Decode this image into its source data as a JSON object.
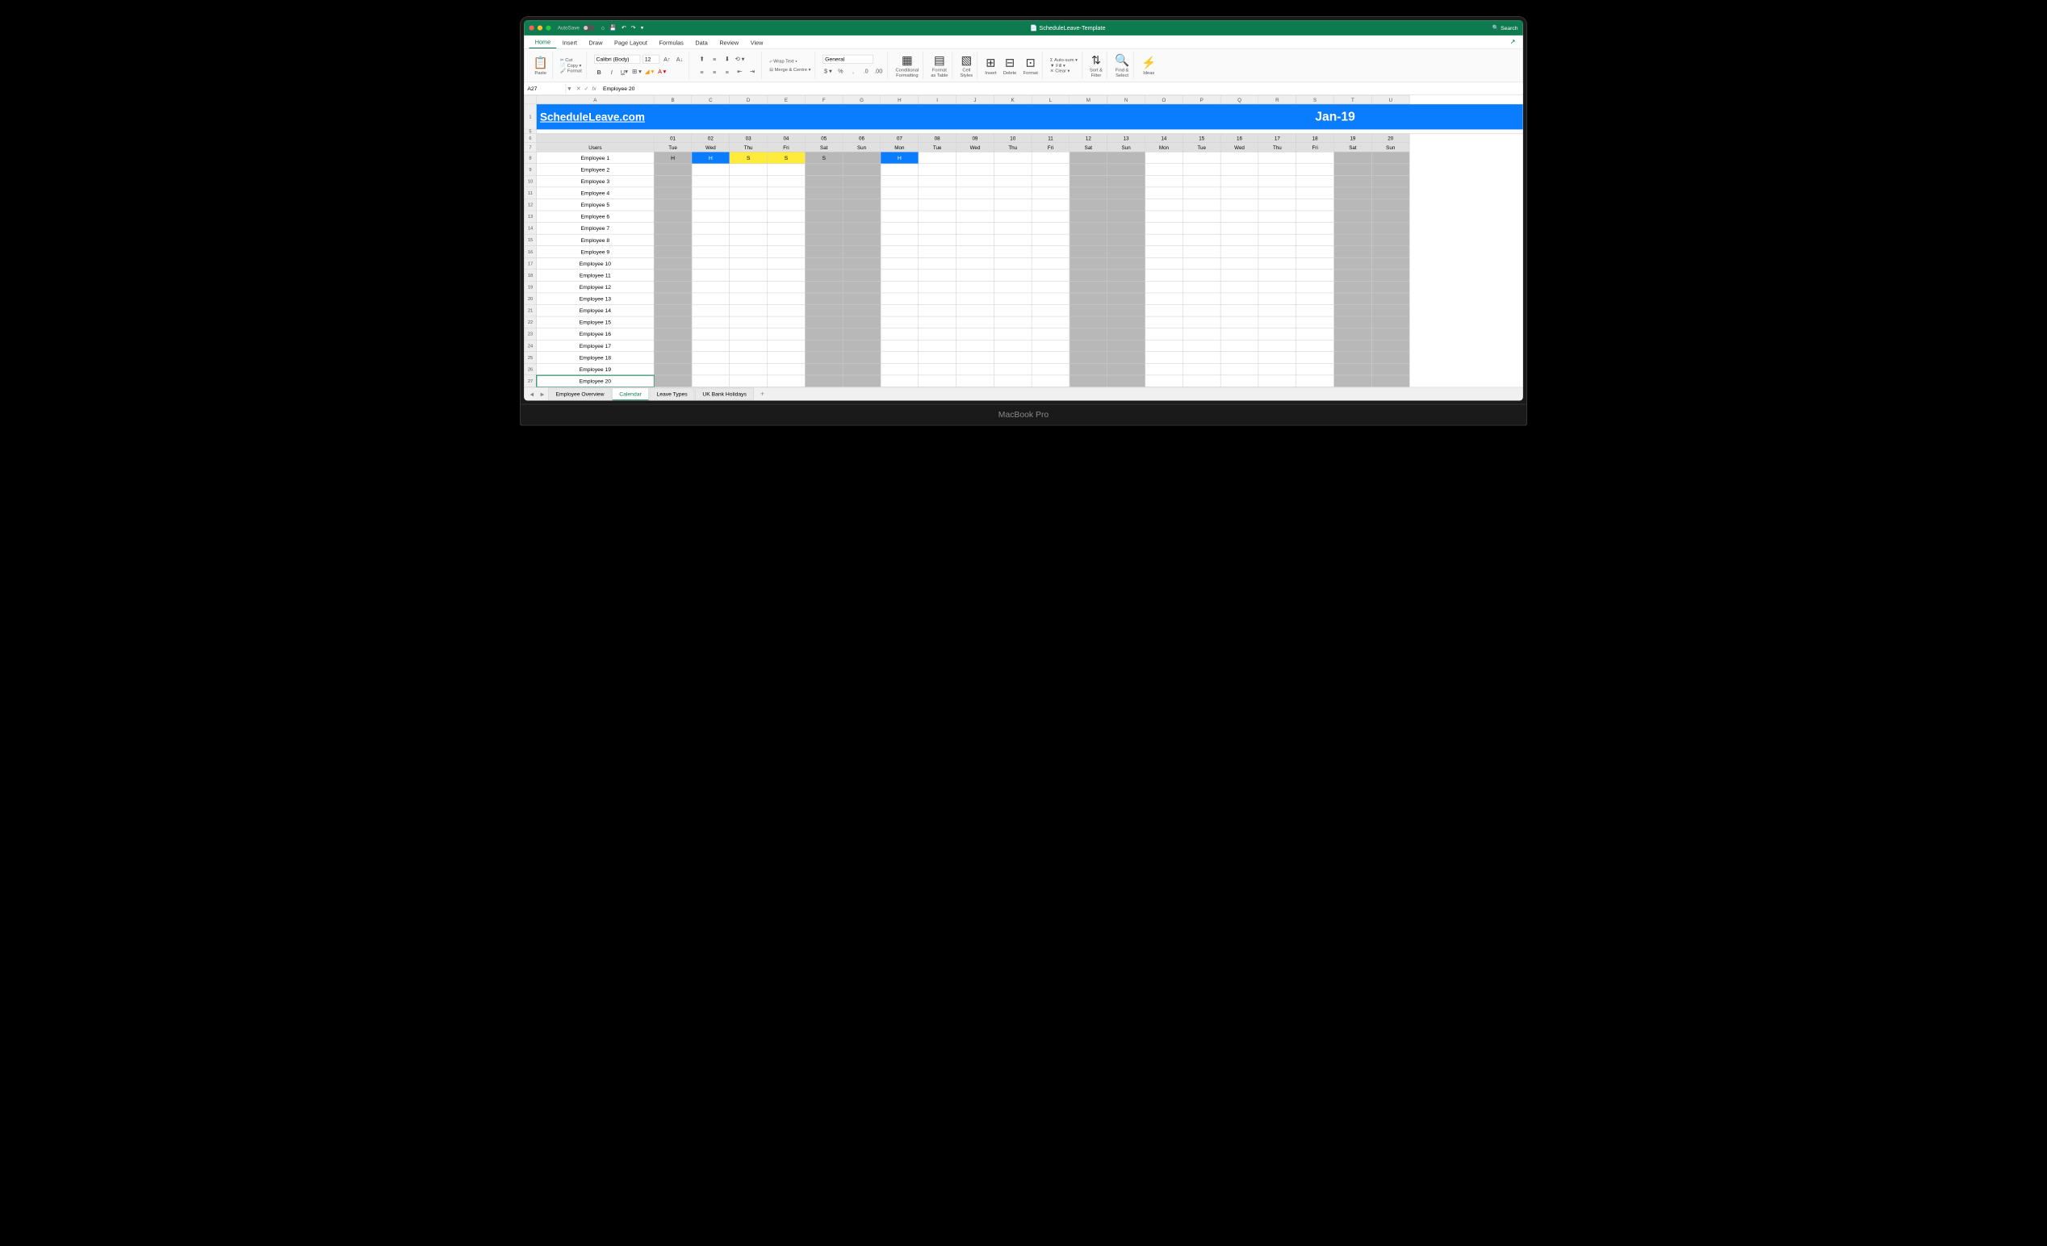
{
  "titlebar": {
    "autosave": "AutoSave",
    "autosave_state": "OFF",
    "filename": "ScheduleLeave-Template",
    "search": "Search"
  },
  "tabs": [
    "Home",
    "Insert",
    "Draw",
    "Page Layout",
    "Formulas",
    "Data",
    "Review",
    "View"
  ],
  "active_tab": "Home",
  "ribbon": {
    "paste": "Paste",
    "cut": "Cut",
    "copy": "Copy",
    "format": "Format",
    "font": "Calibri (Body)",
    "size": "12",
    "wrap": "Wrap Text",
    "merge": "Merge & Centre",
    "numfmt": "General",
    "cond": "Conditional",
    "cond2": "Formatting",
    "fmttbl": "Format",
    "fmttbl2": "as Table",
    "cellsty": "Cell",
    "cellsty2": "Styles",
    "insert": "Insert",
    "delete": "Delete",
    "formatc": "Format",
    "autosum": "Auto-sum",
    "fill": "Fill",
    "clear": "Clear",
    "sort": "Sort &",
    "sort2": "Filter",
    "find": "Find &",
    "find2": "Select",
    "ideas": "Ideas"
  },
  "namebox": "A27",
  "formula": "Employee 20",
  "columns": [
    "A",
    "B",
    "C",
    "D",
    "E",
    "F",
    "G",
    "H",
    "I",
    "J",
    "K",
    "L",
    "M",
    "N",
    "O",
    "P",
    "Q",
    "R",
    "S",
    "T",
    "U"
  ],
  "banner": {
    "brand": "ScheduleLeave.com",
    "month": "Jan-19"
  },
  "dates": [
    "01",
    "02",
    "03",
    "04",
    "05",
    "06",
    "07",
    "08",
    "09",
    "10",
    "11",
    "12",
    "13",
    "14",
    "15",
    "16",
    "17",
    "18",
    "19",
    "20"
  ],
  "days": [
    "Tue",
    "Wed",
    "Thu",
    "Fri",
    "Sat",
    "Sun",
    "Mon",
    "Tue",
    "Wed",
    "Thu",
    "Fri",
    "Sat",
    "Sun",
    "Mon",
    "Tue",
    "Wed",
    "Thu",
    "Fri",
    "Sat",
    "Sun"
  ],
  "users_label": "Users",
  "employees": [
    "Employee 1",
    "Employee 2",
    "Employee 3",
    "Employee 4",
    "Employee 5",
    "Employee 6",
    "Employee 7",
    "Employee 8",
    "Employee 9",
    "Employee 10",
    "Employee 11",
    "Employee 12",
    "Employee 13",
    "Employee 14",
    "Employee 15",
    "Employee 16",
    "Employee 17",
    "Employee 18",
    "Employee 19",
    "Employee 20"
  ],
  "row_numbers_start": 1,
  "leave_data": {
    "0": {
      "1": {
        "v": "H",
        "c": "blue"
      },
      "2": {
        "v": "S",
        "c": "yellow"
      },
      "3": {
        "v": "S",
        "c": "yellow"
      },
      "4": {
        "v": "S",
        "c": "grey"
      },
      "6": {
        "v": "H",
        "c": "blue"
      }
    }
  },
  "grey_cols": [
    0,
    4,
    5,
    11,
    12,
    18,
    19
  ],
  "first_col_grey": true,
  "sheet_tabs": [
    "Employee Overview",
    "Calendar",
    "Leave Types",
    "UK Bank Holidays"
  ],
  "active_sheet": "Calendar",
  "laptop_label": "MacBook Pro"
}
